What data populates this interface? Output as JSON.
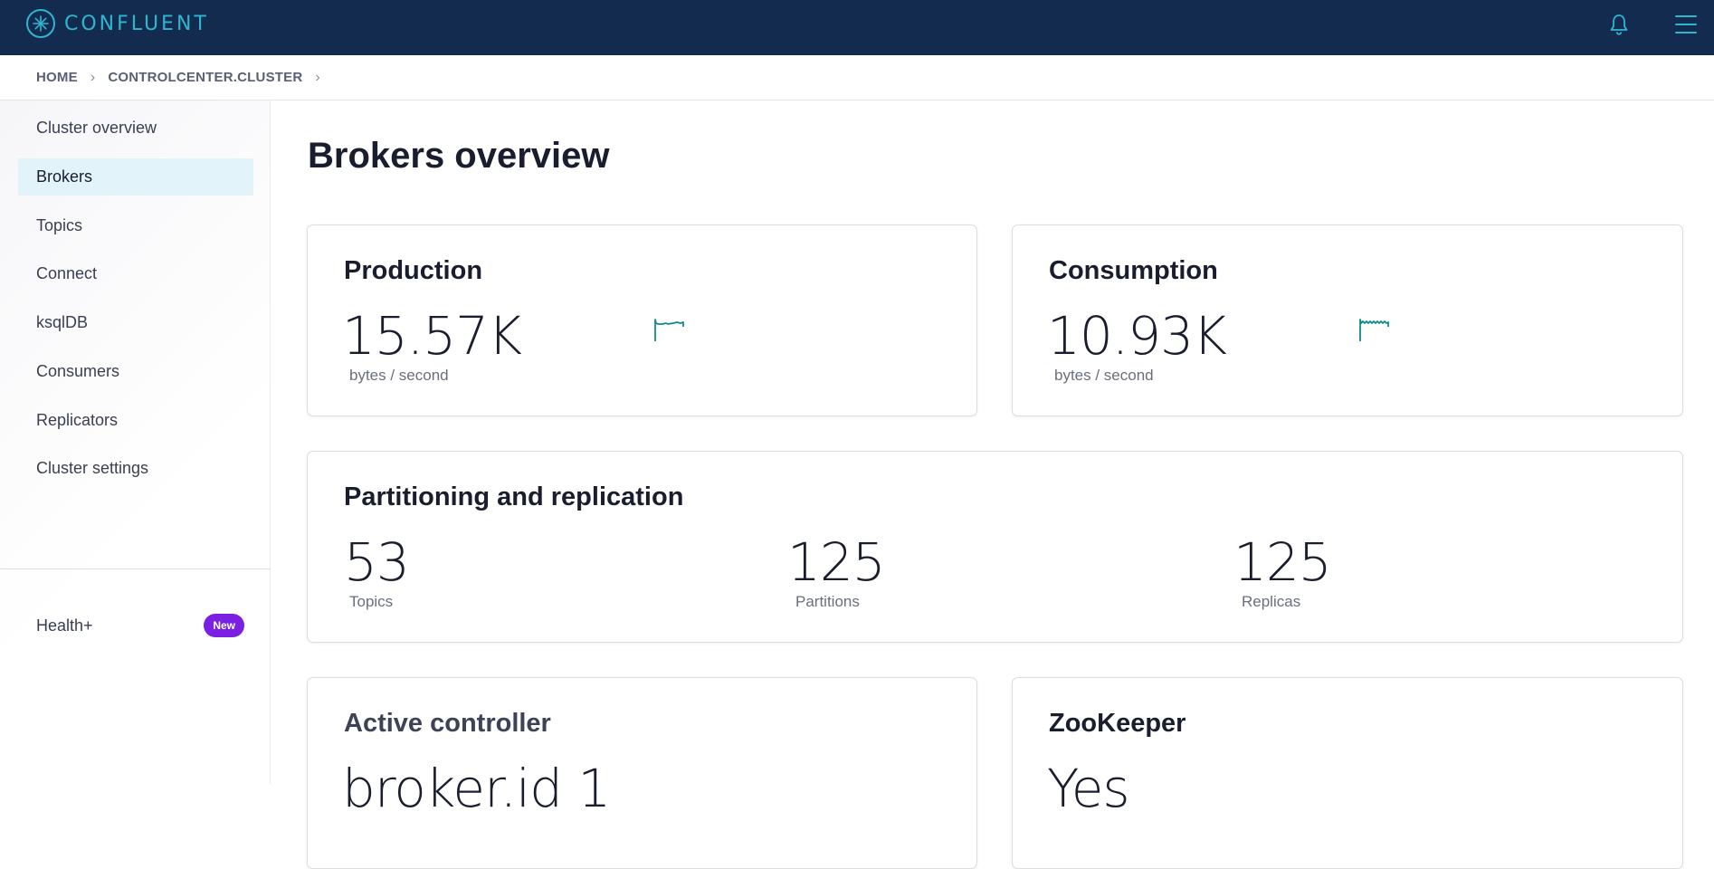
{
  "header": {
    "brand": "CONFLUENT",
    "logo_icon": "confluent-logo-icon",
    "notification_icon": "bell-icon",
    "menu_icon": "hamburger-menu-icon"
  },
  "breadcrumb": {
    "items": [
      "HOME",
      "CONTROLCENTER.CLUSTER"
    ],
    "separator": "›"
  },
  "sidebar": {
    "items": [
      {
        "label": "Cluster overview",
        "active": false
      },
      {
        "label": "Brokers",
        "active": true
      },
      {
        "label": "Topics",
        "active": false
      },
      {
        "label": "Connect",
        "active": false
      },
      {
        "label": "ksqlDB",
        "active": false
      },
      {
        "label": "Consumers",
        "active": false
      },
      {
        "label": "Replicators",
        "active": false
      },
      {
        "label": "Cluster settings",
        "active": false
      }
    ],
    "health": {
      "label": "Health+",
      "badge": "New"
    }
  },
  "main": {
    "title": "Brokers overview",
    "production": {
      "title": "Production",
      "value": "15.57K",
      "unit": "bytes / second"
    },
    "consumption": {
      "title": "Consumption",
      "value": "10.93K",
      "unit": "bytes / second"
    },
    "partitioning": {
      "title": "Partitioning and replication",
      "stats": [
        {
          "value": "53",
          "label": "Topics"
        },
        {
          "value": "125",
          "label": "Partitions"
        },
        {
          "value": "125",
          "label": "Replicas"
        }
      ]
    },
    "active_controller": {
      "title": "Active controller",
      "value": "broker.id 1"
    },
    "zookeeper": {
      "title": "ZooKeeper",
      "value": "Yes"
    }
  },
  "colors": {
    "topbar": "#142b50",
    "brand_accent": "#2fb6cf",
    "sparkline": "#0e8a8a",
    "active_nav_bg": "#e3f3fa",
    "badge": "#7b1fe3"
  }
}
